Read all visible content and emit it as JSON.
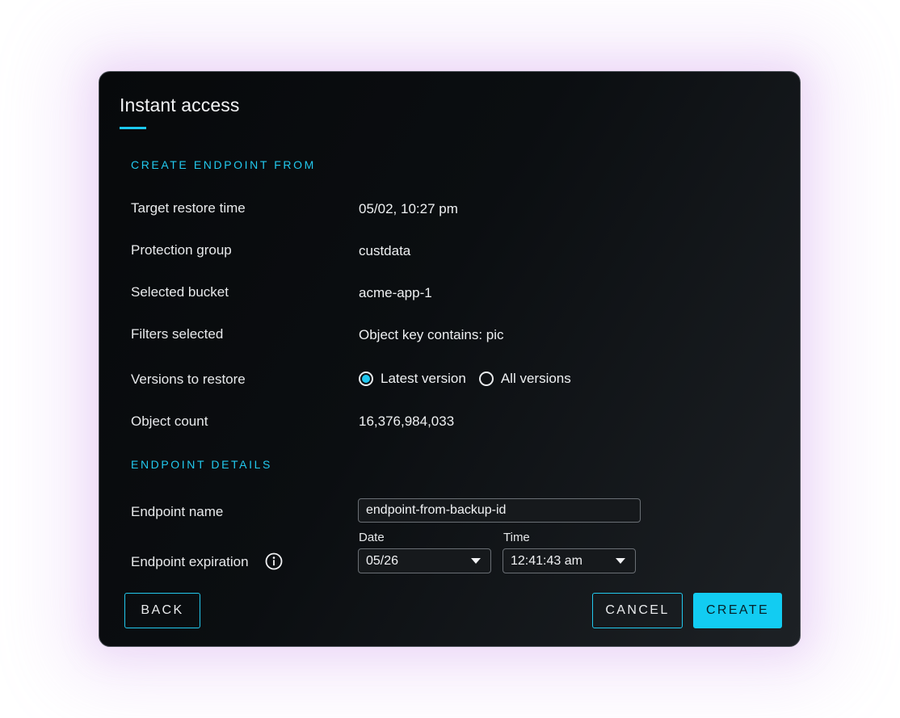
{
  "dialog": {
    "title": "Instant access"
  },
  "create_endpoint_from": {
    "heading": "CREATE ENDPOINT FROM",
    "rows": [
      {
        "label": "Target restore time",
        "value": "05/02, 10:27 pm"
      },
      {
        "label": "Protection group",
        "value": "custdata"
      },
      {
        "label": "Selected bucket",
        "value": "acme-app-1"
      },
      {
        "label": "Filters selected",
        "value": "Object key contains: pic"
      }
    ],
    "versions": {
      "label": "Versions to restore",
      "options": [
        {
          "label": "Latest version",
          "selected": true
        },
        {
          "label": "All versions",
          "selected": false
        }
      ]
    },
    "object_count": {
      "label": "Object count",
      "value": "16,376,984,033"
    }
  },
  "endpoint_details": {
    "heading": "ENDPOINT DETAILS",
    "name": {
      "label": "Endpoint name",
      "value": "endpoint-from-backup-id"
    },
    "expiration": {
      "label": "Endpoint expiration",
      "info_icon": "info-icon",
      "date_caption": "Date",
      "date_value": "05/26",
      "time_caption": "Time",
      "time_value": "12:41:43 am"
    }
  },
  "buttons": {
    "back": "BACK",
    "cancel": "CANCEL",
    "create": "CREATE"
  },
  "colors": {
    "accent": "#12ccf2",
    "dialog_background": "#0b0e11",
    "border": "#4a4f56"
  }
}
